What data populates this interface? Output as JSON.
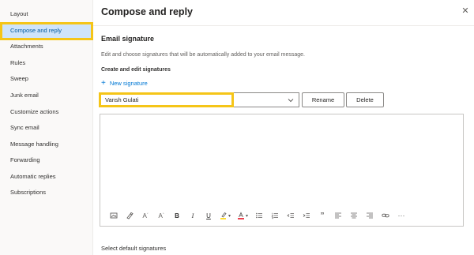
{
  "sidebar": {
    "items": [
      {
        "label": "Layout",
        "active": false
      },
      {
        "label": "Compose and reply",
        "active": true
      },
      {
        "label": "Attachments",
        "active": false
      },
      {
        "label": "Rules",
        "active": false
      },
      {
        "label": "Sweep",
        "active": false
      },
      {
        "label": "Junk email",
        "active": false
      },
      {
        "label": "Customize actions",
        "active": false
      },
      {
        "label": "Sync email",
        "active": false
      },
      {
        "label": "Message handling",
        "active": false
      },
      {
        "label": "Forwarding",
        "active": false
      },
      {
        "label": "Automatic replies",
        "active": false
      },
      {
        "label": "Subscriptions",
        "active": false
      }
    ]
  },
  "main": {
    "title": "Compose and reply",
    "close_icon": "close-icon",
    "email_signature": {
      "heading": "Email signature",
      "description": "Edit and choose signatures that will be automatically added to your email message.",
      "subheading": "Create and edit signatures",
      "new_signature_label": "New signature",
      "selected_signature": "Vansh Gulati",
      "rename_label": "Rename",
      "delete_label": "Delete"
    },
    "toolbar_icons": [
      "insert-image-icon",
      "format-painter-icon",
      "decrease-font-size-icon",
      "increase-font-size-icon",
      "bold-icon",
      "italic-icon",
      "underline-icon",
      "highlight-icon",
      "font-color-icon",
      "bullets-icon",
      "numbering-icon",
      "decrease-indent-icon",
      "increase-indent-icon",
      "quote-icon",
      "align-left-icon",
      "align-center-icon",
      "align-right-icon",
      "insert-link-icon",
      "more-options-icon"
    ],
    "footer_label": "Select default signatures"
  },
  "colors": {
    "accent": "#0078d4",
    "active_nav_bg": "#cfe4fa",
    "highlight_annotation": "#f5c518",
    "highlight_yellow": "#ffd600",
    "font_color_red": "#e81123"
  }
}
